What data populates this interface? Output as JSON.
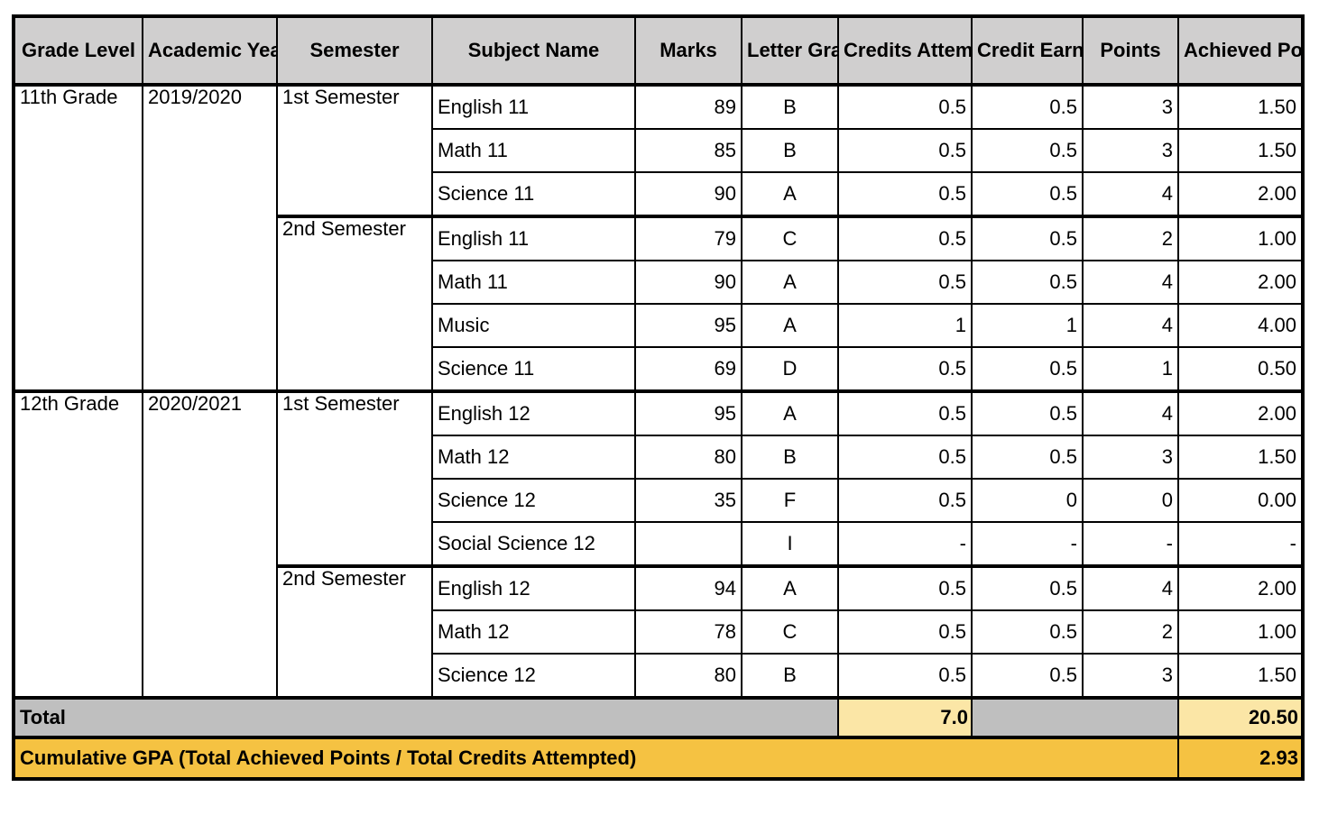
{
  "headers": {
    "grade_level": "Grade Level",
    "academic_year": "Academic Year",
    "semester": "Semester",
    "subject_name": "Subject Name",
    "marks": "Marks",
    "letter_grade": "Letter Grade",
    "credits_attempted": "Credits Attempted",
    "credit_earned": "Credit Earned",
    "points": "Points",
    "achieved_points": "Achieved Points"
  },
  "groups": [
    {
      "grade_level": "11th Grade",
      "academic_year": "2019/2020",
      "semesters": [
        {
          "name": "1st Semester",
          "rows": [
            {
              "subject": "English 11",
              "marks": "89",
              "letter": "B",
              "attempted": "0.5",
              "earned": "0.5",
              "points": "3",
              "achieved": "1.50"
            },
            {
              "subject": "Math 11",
              "marks": "85",
              "letter": "B",
              "attempted": "0.5",
              "earned": "0.5",
              "points": "3",
              "achieved": "1.50"
            },
            {
              "subject": "Science 11",
              "marks": "90",
              "letter": "A",
              "attempted": "0.5",
              "earned": "0.5",
              "points": "4",
              "achieved": "2.00"
            }
          ]
        },
        {
          "name": "2nd Semester",
          "rows": [
            {
              "subject": "English 11",
              "marks": "79",
              "letter": "C",
              "attempted": "0.5",
              "earned": "0.5",
              "points": "2",
              "achieved": "1.00"
            },
            {
              "subject": "Math 11",
              "marks": "90",
              "letter": "A",
              "attempted": "0.5",
              "earned": "0.5",
              "points": "4",
              "achieved": "2.00"
            },
            {
              "subject": "Music",
              "marks": "95",
              "letter": "A",
              "attempted": "1",
              "earned": "1",
              "points": "4",
              "achieved": "4.00"
            },
            {
              "subject": "Science 11",
              "marks": "69",
              "letter": "D",
              "attempted": "0.5",
              "earned": "0.5",
              "points": "1",
              "achieved": "0.50"
            }
          ]
        }
      ]
    },
    {
      "grade_level": "12th Grade",
      "academic_year": "2020/2021",
      "semesters": [
        {
          "name": "1st Semester",
          "rows": [
            {
              "subject": "English 12",
              "marks": "95",
              "letter": "A",
              "attempted": "0.5",
              "earned": "0.5",
              "points": "4",
              "achieved": "2.00"
            },
            {
              "subject": "Math 12",
              "marks": "80",
              "letter": "B",
              "attempted": "0.5",
              "earned": "0.5",
              "points": "3",
              "achieved": "1.50"
            },
            {
              "subject": "Science 12",
              "marks": "35",
              "letter": "F",
              "attempted": "0.5",
              "earned": "0",
              "points": "0",
              "achieved": "0.00"
            },
            {
              "subject": "Social Science 12",
              "marks": "",
              "letter": "I",
              "attempted": "-",
              "earned": "-",
              "points": "-",
              "achieved": "-"
            }
          ]
        },
        {
          "name": "2nd Semester",
          "rows": [
            {
              "subject": "English 12",
              "marks": "94",
              "letter": "A",
              "attempted": "0.5",
              "earned": "0.5",
              "points": "4",
              "achieved": "2.00"
            },
            {
              "subject": "Math 12",
              "marks": "78",
              "letter": "C",
              "attempted": "0.5",
              "earned": "0.5",
              "points": "2",
              "achieved": "1.00"
            },
            {
              "subject": "Science 12",
              "marks": "80",
              "letter": "B",
              "attempted": "0.5",
              "earned": "0.5",
              "points": "3",
              "achieved": "1.50"
            }
          ]
        }
      ]
    }
  ],
  "total": {
    "label": "Total",
    "credits_attempted": "7.0",
    "achieved_points": "20.50"
  },
  "gpa": {
    "label": "Cumulative GPA (Total Achieved Points / Total  Credits Attempted)",
    "value": "2.93"
  },
  "colors": {
    "header_bg": "#d0cfcf",
    "total_bg": "#bfbfbf",
    "total_highlight": "#fbe6a6",
    "gpa_bg": "#f5c242"
  }
}
